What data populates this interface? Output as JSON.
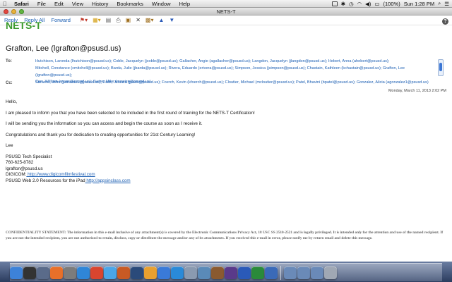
{
  "menubar": {
    "app_name": "Safari",
    "items": [
      "File",
      "Edit",
      "View",
      "History",
      "Bookmarks",
      "Window",
      "Help"
    ],
    "battery": "(100%)",
    "clock": "Sun 1:28 PM"
  },
  "window": {
    "title": "NETS-T"
  },
  "toolbar": {
    "reply": "Reply",
    "reply_all": "Reply All",
    "forward": "Forward"
  },
  "app_title": "NETS-T",
  "message": {
    "sender": "Grafton, Lee (lgrafton@psusd.us)",
    "to_label": "To:",
    "to_line1": "Hutchison, Laronda (lhutchison@psusd.us); Coble, Jacquelyn (jcoble@psusd.us); Gallacher, Angie (agallacher@psusd.us); Langdon, Jacquelyn (jlangdon@psusd.us); Hebert, Anna (ahebert@psusd.us);",
    "to_line2": "Mitchell, Constance (cmitchell@psusd.us); Barda, Julie (jbarda@psusd.us); Rivera, Eduardo (erivera@psusd.us); Simpson, Jessica (jsimpson@psusd.us); Chastain, Kathleen (kchastain@psusd.us); Grafton, Lee (lgrafton@psusd.us);",
    "to_line3": "Stevens, John (jstevens1@psusd.us); Pack, Jessica (jpack@psusd.us); Foerch, Kevin (kfoerch@psusd.us); Cloutier, Michael (mcloutier@psusd.us); Patel, Bhavini (bpatel@psusd.us); Gonzalez, Alicia (agonzalez1@psusd.us)",
    "cc_label": "Cc:",
    "cc_line": "Carr, William (wcarr@psusd.us); Swize, Mike (mswize@psusd.us)",
    "date": "Monday, March 11, 2013 2:02 PM",
    "greeting": "Hello,",
    "para1": "I am pleased to inform you that you have been selected to be included in the first round of training for the NETS-T Certification!",
    "para2": "I will be sending you the information so you can access and begin the course as soon as I receive it.",
    "para3": "Congratulations and thank you for dedication to creating opportunities for 21st Century Learning!",
    "sign_name": "Lee",
    "sig_title": "PSUSD Tech Specialist",
    "sig_phone": "760-625-8782",
    "sig_email": "lgrafton@psusd.us",
    "sig_digicom_label": "DIGICOM:",
    "sig_digicom_url": " http://www.digicomfilmfestival.com",
    "sig_web_label": "PSUSD Web 2.0 Resources for the iPad",
    "sig_web_url": " http://appsinclass.com",
    "confidentiality": "CONFIDENTIALITY STATEMENT: The information in this e-mail inclusive of any attachment(s) is covered by the Electronic Communications Privacy Act, 18 USC SS 2510-2521 and is legally privileged. It is intended only for the attention and use of the named recipient. If you are not the intended recipient, you are not authorized to retain, disclose, copy or distribute the message and/or any of its attachments. If you received this e-mail in error, please notify me by return email and delete this message."
  },
  "dock": {
    "icons": [
      {
        "name": "finder-icon",
        "color": "#3d82d8"
      },
      {
        "name": "dashboard-icon",
        "color": "#333333"
      },
      {
        "name": "mission-control-icon",
        "color": "#5a6b8a"
      },
      {
        "name": "firefox-icon",
        "color": "#e8702a"
      },
      {
        "name": "system-preferences-icon",
        "color": "#7c7c7c"
      },
      {
        "name": "safari-icon",
        "color": "#2f86d8"
      },
      {
        "name": "chrome-icon",
        "color": "#d9452f"
      },
      {
        "name": "messages-icon",
        "color": "#4aa6e8"
      },
      {
        "name": "powerpoint-icon",
        "color": "#c85a24"
      },
      {
        "name": "photoshop-icon",
        "color": "#2a4a7a"
      },
      {
        "name": "pages-icon",
        "color": "#e8a030"
      },
      {
        "name": "itunes-icon",
        "color": "#3a7ad8"
      },
      {
        "name": "app-store-icon",
        "color": "#2a8ad8"
      },
      {
        "name": "preview-icon",
        "color": "#8a9ab0"
      },
      {
        "name": "iphoto-icon",
        "color": "#5a8ab8"
      },
      {
        "name": "garageband-icon",
        "color": "#8a5a30"
      },
      {
        "name": "imovie-icon",
        "color": "#5a3a8a"
      },
      {
        "name": "word-icon",
        "color": "#2a5ab8"
      },
      {
        "name": "excel-icon",
        "color": "#2a8a3a"
      },
      {
        "name": "outlook-icon",
        "color": "#3a6ab8"
      }
    ],
    "right_icons": [
      {
        "name": "folder-icon",
        "color": "#6a8ab8"
      },
      {
        "name": "downloads-icon",
        "color": "#6a8ab8"
      },
      {
        "name": "documents-icon",
        "color": "#6a8ab8"
      },
      {
        "name": "trash-icon",
        "color": "#a0a8b4"
      }
    ]
  }
}
